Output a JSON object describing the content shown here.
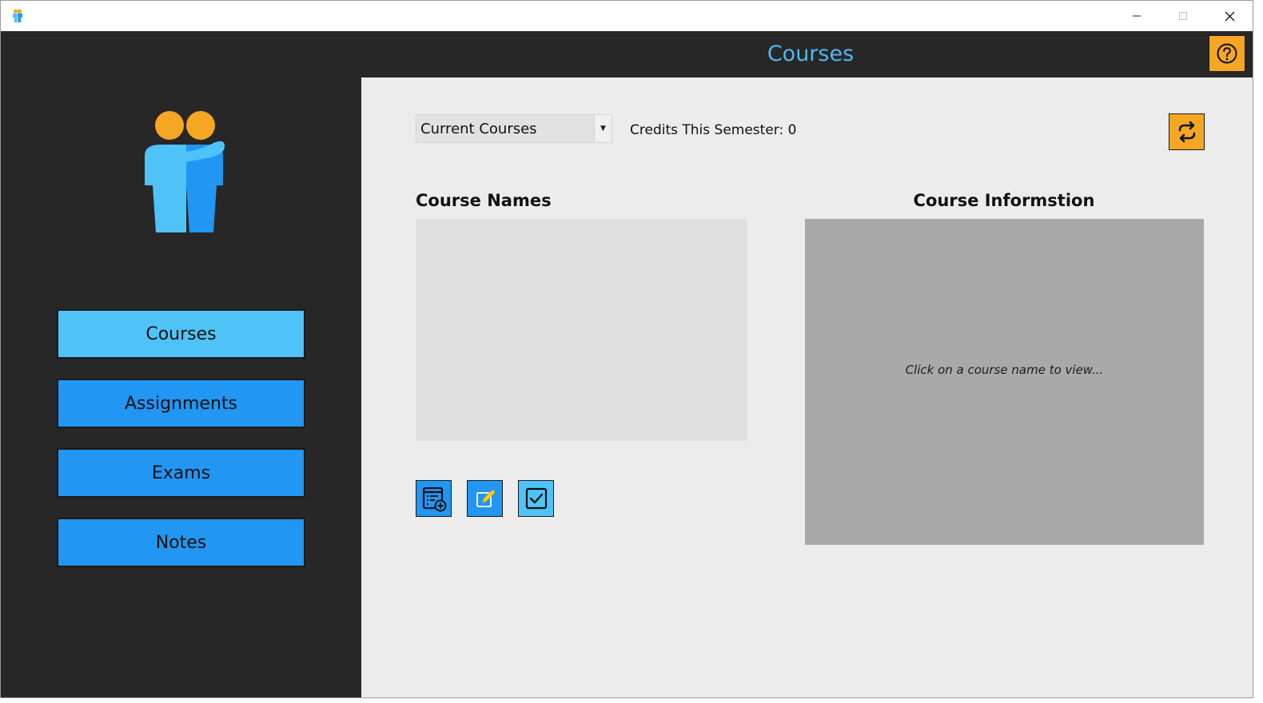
{
  "header": {
    "title": "Courses"
  },
  "sidebar": {
    "nav": [
      {
        "label": "Courses"
      },
      {
        "label": "Assignments"
      },
      {
        "label": "Exams"
      },
      {
        "label": "Notes"
      }
    ]
  },
  "main": {
    "course_filter": {
      "selected": "Current Courses"
    },
    "credits_text": "Credits This Semester: 0",
    "course_names_label": "Course Names",
    "course_info_label": "Course Informstion",
    "course_info_placeholder": "Click on a course name to view..."
  },
  "colors": {
    "sidebar_bg": "#272727",
    "accent_blue": "#2196f3",
    "active_blue": "#4fc3f7",
    "title_blue": "#4fb7ef",
    "accent_orange": "#f5a623"
  },
  "icons": {
    "app": "people-icon",
    "help": "question-circle-icon",
    "refresh": "refresh-icon",
    "add": "add-list-icon",
    "edit": "edit-icon",
    "complete": "checkbox-icon"
  }
}
